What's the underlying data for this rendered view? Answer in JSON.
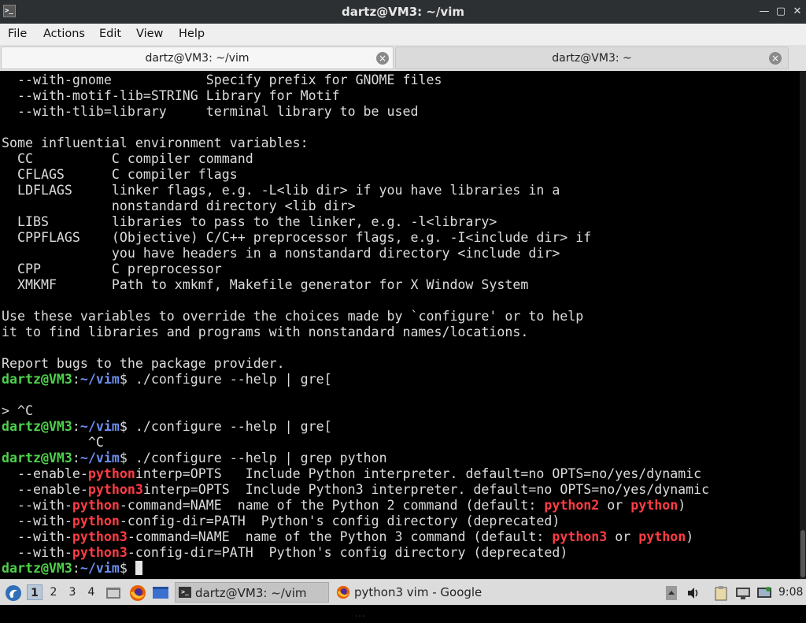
{
  "window": {
    "title": "dartz@VM3: ~/vim"
  },
  "menu": {
    "file": "File",
    "actions": "Actions",
    "edit": "Edit",
    "view": "View",
    "help": "Help"
  },
  "tabs": [
    {
      "label": "dartz@VM3: ~/vim"
    },
    {
      "label": "dartz@VM3: ~"
    }
  ],
  "terminal": {
    "user": "dartz@VM3",
    "path": "~/vim",
    "help_lines": [
      "  --with-gnome            Specify prefix for GNOME files",
      "  --with-motif-lib=STRING Library for Motif",
      "  --with-tlib=library     terminal library to be used",
      "",
      "Some influential environment variables:",
      "  CC          C compiler command",
      "  CFLAGS      C compiler flags",
      "  LDFLAGS     linker flags, e.g. -L<lib dir> if you have libraries in a",
      "              nonstandard directory <lib dir>",
      "  LIBS        libraries to pass to the linker, e.g. -l<library>",
      "  CPPFLAGS    (Objective) C/C++ preprocessor flags, e.g. -I<include dir> if",
      "              you have headers in a nonstandard directory <include dir>",
      "  CPP         C preprocessor",
      "  XMKMF       Path to xmkmf, Makefile generator for X Window System",
      "",
      "Use these variables to override the choices made by `configure' or to help",
      "it to find libraries and programs with nonstandard names/locations.",
      "",
      "Report bugs to the package provider."
    ],
    "cmd1": " ./configure --help | gre[",
    "blank1": "",
    "cont1": "> ^C",
    "cmd2": " ./configure --help | gre[",
    "cont2": "           ^C",
    "cmd3": " ./configure --help | grep python",
    "grep_results": [
      [
        {
          "t": "  --enable-"
        },
        {
          "t": "python",
          "h": true
        },
        {
          "t": "interp=OPTS   Include Python interpreter. default=no OPTS=no/yes/dynamic"
        }
      ],
      [
        {
          "t": "  --enable-"
        },
        {
          "t": "python3",
          "h": true
        },
        {
          "t": "interp=OPTS  Include Python3 interpreter. default=no OPTS=no/yes/dynamic"
        }
      ],
      [
        {
          "t": "  --with-"
        },
        {
          "t": "python",
          "h": true
        },
        {
          "t": "-command=NAME  name of the Python 2 command (default: "
        },
        {
          "t": "python2",
          "h": true
        },
        {
          "t": " or "
        },
        {
          "t": "python",
          "h": true
        },
        {
          "t": ")"
        }
      ],
      [
        {
          "t": "  --with-"
        },
        {
          "t": "python",
          "h": true
        },
        {
          "t": "-config-dir=PATH  Python's config directory (deprecated)"
        }
      ],
      [
        {
          "t": "  --with-"
        },
        {
          "t": "python3",
          "h": true
        },
        {
          "t": "-command=NAME  name of the Python 3 command (default: "
        },
        {
          "t": "python3",
          "h": true
        },
        {
          "t": " or "
        },
        {
          "t": "python",
          "h": true
        },
        {
          "t": ")"
        }
      ],
      [
        {
          "t": "  --with-"
        },
        {
          "t": "python3",
          "h": true
        },
        {
          "t": "-config-dir=PATH  Python's config directory (deprecated)"
        }
      ]
    ],
    "prompt_suffix": "$",
    "cmd4": " "
  },
  "taskbar": {
    "workspaces": [
      "1",
      "2",
      "3",
      "4"
    ],
    "active_workspace": "1",
    "tasks": [
      {
        "label": "dartz@VM3: ~/vim",
        "icon": "terminal-icon"
      },
      {
        "label": "python3 vim - Google ...",
        "icon": "firefox-icon"
      }
    ],
    "clock": "9:08"
  },
  "colors": {
    "prompt_user": "#4ed24a",
    "prompt_path": "#6c8ef0",
    "match_highlight": "#ff3c44",
    "terminal_bg": "#000000",
    "terminal_fg": "#dcdcdc"
  }
}
